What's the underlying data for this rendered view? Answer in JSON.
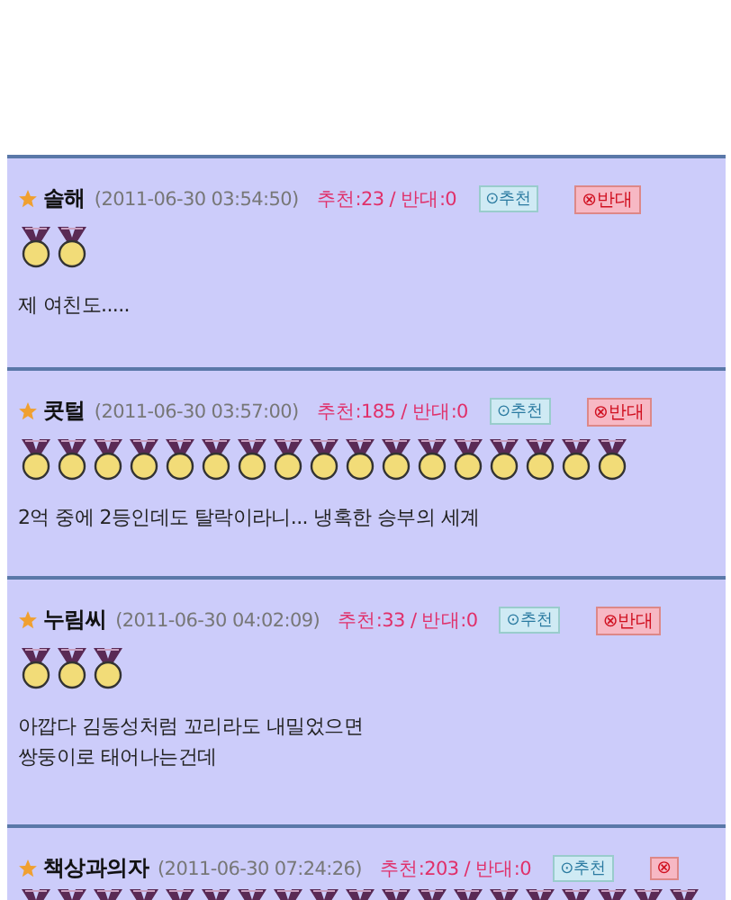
{
  "comments": [
    {
      "author": "솔해",
      "time": "(2011-06-30 03:54:50)",
      "votes": "추천:23 / 반대:0",
      "up_button": "⊙추천",
      "down_button": "⊗반대",
      "medals": [
        {
          "kind": "gold"
        },
        {
          "kind": "gold"
        }
      ],
      "lines": [
        "제 여친도....."
      ]
    },
    {
      "author": "콧털",
      "time": "(2011-06-30 03:57:00)",
      "votes": "추천:185 / 반대:0",
      "up_button": "⊙추천",
      "down_button": "⊗반대",
      "medals": [
        {
          "kind": "gold"
        },
        {
          "kind": "gold"
        },
        {
          "kind": "gold"
        },
        {
          "kind": "gold"
        },
        {
          "kind": "gold"
        },
        {
          "kind": "gold"
        },
        {
          "kind": "gold"
        },
        {
          "kind": "gold"
        },
        {
          "kind": "gold"
        },
        {
          "kind": "gold"
        },
        {
          "kind": "gold"
        },
        {
          "kind": "gold"
        },
        {
          "kind": "gold"
        },
        {
          "kind": "gold"
        },
        {
          "kind": "gold"
        },
        {
          "kind": "gold"
        },
        {
          "kind": "gold"
        }
      ],
      "lines": [
        "2억 중에 2등인데도 탈락이라니... 냉혹한 승부의 세계"
      ]
    },
    {
      "author": "누림씨",
      "time": "(2011-06-30 04:02:09)",
      "votes": "추천:33 / 반대:0",
      "up_button": "⊙추천",
      "down_button": "⊗반대",
      "medals": [
        {
          "kind": "gold"
        },
        {
          "kind": "gold"
        },
        {
          "kind": "gold"
        }
      ],
      "lines": [
        "아깝다 김동성처럼 꼬리라도 내밀었으면",
        "쌍둥이로 태어나는건데"
      ]
    },
    {
      "author": "책상과의자",
      "time": "(2011-06-30 07:24:26)",
      "votes": "추천:203 / 반대:0",
      "up_button": "⊙추천",
      "down_button": "⊗",
      "medals": [
        {
          "kind": "gold"
        },
        {
          "kind": "gold"
        },
        {
          "kind": "gold"
        },
        {
          "kind": "gold"
        },
        {
          "kind": "gold"
        },
        {
          "kind": "gold"
        },
        {
          "kind": "gold"
        },
        {
          "kind": "gold"
        },
        {
          "kind": "gold"
        },
        {
          "kind": "gold"
        },
        {
          "kind": "gold"
        },
        {
          "kind": "gold"
        },
        {
          "kind": "gold"
        },
        {
          "kind": "gold"
        },
        {
          "kind": "gold"
        },
        {
          "kind": "gold"
        },
        {
          "kind": "gold"
        },
        {
          "kind": "gold"
        },
        {
          "kind": "gold"
        }
      ]
    }
  ]
}
